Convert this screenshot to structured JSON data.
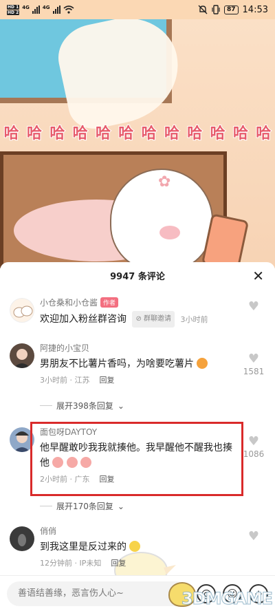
{
  "status_bar": {
    "sim1": "HD 1",
    "sim2": "HD 2",
    "network": "4G",
    "battery": "87",
    "time": "14:53"
  },
  "video": {
    "overlay_text": [
      "哈",
      "哈",
      "哈",
      "哈",
      "哈",
      "哈",
      "哈",
      "哈",
      "哈",
      "哈",
      "哈",
      "哈"
    ]
  },
  "sheet": {
    "title": "9947 条评论",
    "close_icon": "close-icon"
  },
  "comments": [
    {
      "username": "小仓桑和小仓酱",
      "tag": "作者",
      "text": "欢迎加入粉丝群咨询",
      "chip": "群聊邀请",
      "time": "3小时前",
      "likes": ""
    },
    {
      "username": "阿捷的小宝贝",
      "text": "男朋友不比薯片香吗，为啥要吃薯片",
      "time": "3小时前 · 江苏",
      "reply": "回复",
      "likes": "1581",
      "expand": "展开398条回复"
    },
    {
      "username": "面包呀DAYTOY",
      "text": "他早醒敢吵我我就揍他。我早醒他不醒我也揍他",
      "time": "2小时前 · 广东",
      "reply": "回复",
      "likes": "1086",
      "expand": "展开170条回复"
    },
    {
      "username": "俏俏",
      "text": "到我这里是反过来的",
      "time": "12分钟前 · IP未知",
      "reply": "回复",
      "likes": ""
    }
  ],
  "input": {
    "placeholder": "善语结善缘，恶言伤人心~"
  },
  "watermark": "3DMGAME"
}
